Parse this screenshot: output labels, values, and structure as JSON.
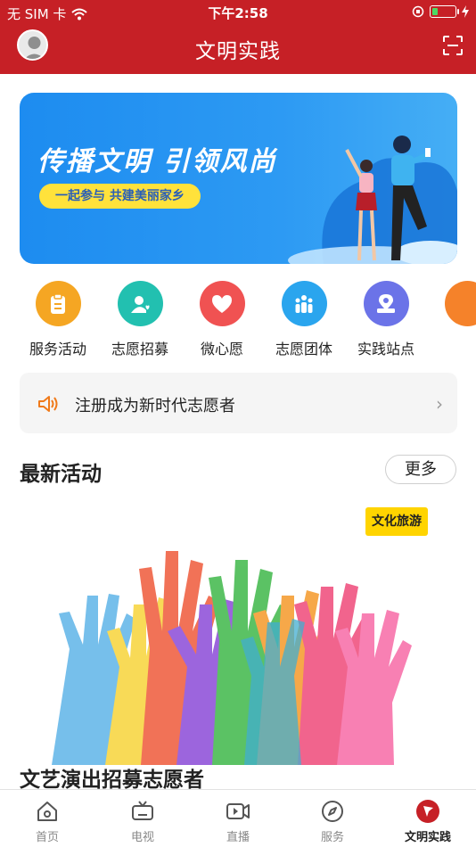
{
  "status_bar": {
    "carrier": "无 SIM 卡",
    "time": "下午2:58",
    "wifi_icon": "wifi-icon",
    "battery_level": 0.25
  },
  "header": {
    "title": "文明实践",
    "avatar_icon": "avatar-icon",
    "scan_icon": "scan-icon"
  },
  "banner": {
    "headline": "传播文明 引领风尚",
    "subline": "一起参与 共建美丽家乡"
  },
  "quick_actions": [
    {
      "label": "服务活动",
      "icon": "clipboard-icon",
      "color": "#f5a623"
    },
    {
      "label": "志愿招募",
      "icon": "user-heart-icon",
      "color": "#22c0b0"
    },
    {
      "label": "微心愿",
      "icon": "heart-icon",
      "color": "#f05252"
    },
    {
      "label": "志愿团体",
      "icon": "group-icon",
      "color": "#2aa5ee"
    },
    {
      "label": "实践站点",
      "icon": "location-pin-icon",
      "color": "#6b73e8"
    },
    {
      "label": "",
      "icon": "more-icon",
      "color": "#f5822a"
    }
  ],
  "notice": {
    "text": "注册成为新时代志愿者",
    "icon": "speaker-icon"
  },
  "latest": {
    "title": "最新活动",
    "more_label": "更多",
    "card": {
      "tag": "文化旅游",
      "title": "文艺演出招募志愿者"
    }
  },
  "tabbar": [
    {
      "label": "首页",
      "icon": "home-icon",
      "active": false
    },
    {
      "label": "电视",
      "icon": "tv-icon",
      "active": false
    },
    {
      "label": "直播",
      "icon": "live-video-icon",
      "active": false
    },
    {
      "label": "服务",
      "icon": "compass-icon",
      "active": false
    },
    {
      "label": "文明实践",
      "icon": "flag-icon",
      "active": true
    }
  ],
  "colors": {
    "brand_red": "#c62026",
    "banner_blue": "#1d8cf0",
    "tag_yellow": "#ffd400"
  }
}
